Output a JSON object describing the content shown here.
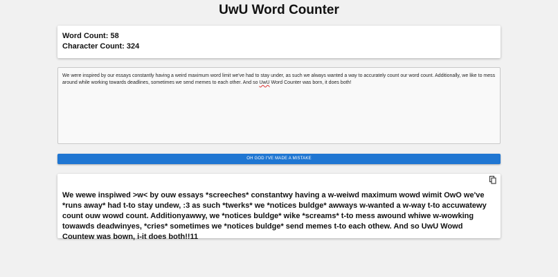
{
  "header": {
    "title": "UwU Word Counter"
  },
  "stats": {
    "word_count_label": "Word Count:",
    "word_count": "58",
    "character_count_label": "Character Count:",
    "character_count": "324"
  },
  "input": {
    "text_before": "We were inspired by our essays constantly having a weird maximum word limit we've had to stay under, as such we always wanted a way to accurately count our word count. Additionally, we like to mess around while working towards deadlines, sometimes we send memes to each other. And so ",
    "text_misspelled": "UwU",
    "text_after": " Word Counter was born, it does both!"
  },
  "actions": {
    "convert_label": "OH GOD I'VE MADE A MISTAKE"
  },
  "output": {
    "text": "We wewe inspiwed >w< by ouw essays *screeches* constantwy having a w-weiwd maximum wowd wimit OwO we've *runs away* had t-to stay undew, :3 as such *twerks* we *notices buldge* awways w-wanted a w-way t-to accuwatewy count ouw wowd count. Additionyawwy, we *notices buldge* wike *screams* t-to mess awound whiwe w-wowking towawds deadwinyes, *cries* sometimes we *notices buldge* send memes t-to each othew. And so UwU Wowd Countew was bown, i-it does both!!11",
    "copy_icon": "copy-icon"
  },
  "colors": {
    "background": "#f1f1f1",
    "button": "#1f76d2",
    "card": "#ffffff"
  }
}
